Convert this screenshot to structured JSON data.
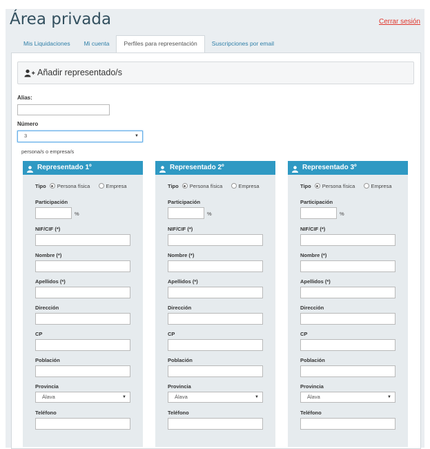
{
  "header": {
    "title": "Área privada",
    "logout_label": "Cerrar sesión"
  },
  "tabs": [
    {
      "label": "Mis Liquidaciones",
      "active": false
    },
    {
      "label": "Mi cuenta",
      "active": false
    },
    {
      "label": "Perfiles para representación",
      "active": true
    },
    {
      "label": "Suscripciones por email",
      "active": false
    }
  ],
  "form": {
    "section_title": "Añadir representado/s",
    "alias_label": "Alias:",
    "alias_value": "",
    "number_label": "Número",
    "number_value": "3",
    "number_hint": "persona/s o empresa/s"
  },
  "cards": [
    {
      "title": "Representado 1º",
      "tipo_label": "Tipo",
      "tipo_options": [
        "Persona física",
        "Empresa"
      ],
      "tipo_selected": "Persona física",
      "participacion_label": "Participación",
      "percent_unit": "%",
      "nif_label": "NIF/CIF (*)",
      "nombre_label": "Nombre (*)",
      "apellidos_label": "Apellidos (*)",
      "direccion_label": "Dirección",
      "cp_label": "CP",
      "poblacion_label": "Población",
      "provincia_label": "Provincia",
      "provincia_value": "Álava",
      "telefono_label": "Teléfono"
    },
    {
      "title": "Representado 2º",
      "tipo_label": "Tipo",
      "tipo_options": [
        "Persona física",
        "Empresa"
      ],
      "tipo_selected": "Persona física",
      "participacion_label": "Participación",
      "percent_unit": "%",
      "nif_label": "NIF/CIF (*)",
      "nombre_label": "Nombre (*)",
      "apellidos_label": "Apellidos (*)",
      "direccion_label": "Dirección",
      "cp_label": "CP",
      "poblacion_label": "Población",
      "provincia_label": "Provincia",
      "provincia_value": "Álava",
      "telefono_label": "Teléfono"
    },
    {
      "title": "Representado 3º",
      "tipo_label": "Tipo",
      "tipo_options": [
        "Persona física",
        "Empresa"
      ],
      "tipo_selected": "Persona física",
      "participacion_label": "Participación",
      "percent_unit": "%",
      "nif_label": "NIF/CIF (*)",
      "nombre_label": "Nombre (*)",
      "apellidos_label": "Apellidos (*)",
      "direccion_label": "Dirección",
      "cp_label": "CP",
      "poblacion_label": "Población",
      "provincia_label": "Provincia",
      "provincia_value": "Álava",
      "telefono_label": "Teléfono"
    }
  ],
  "icons": {
    "add_user": "add-user-icon",
    "user": "user-icon",
    "caret": "chevron-down-icon"
  },
  "colors": {
    "accent": "#2f99c3",
    "title": "#33505f",
    "link": "#2f7fa8",
    "logout": "#e0352c",
    "card_bg": "#e6ebee",
    "frame_bg": "#eaeef1"
  }
}
